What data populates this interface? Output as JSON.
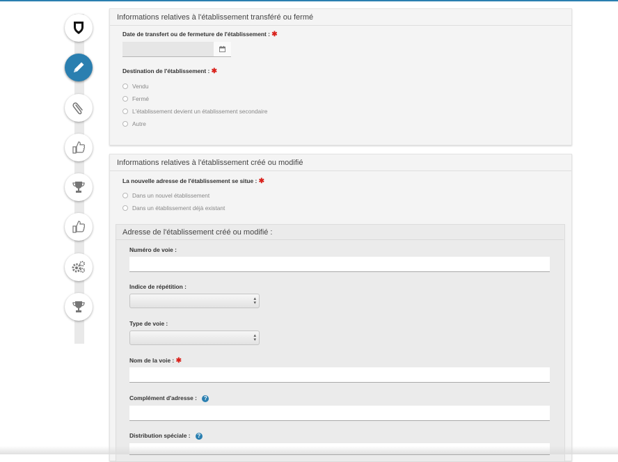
{
  "accent_color": "#2a7fb0",
  "required_color": "#d9211b",
  "steps": [
    {
      "icon": "shield-icon",
      "active": false
    },
    {
      "icon": "pencil-icon",
      "active": true
    },
    {
      "icon": "paperclip-icon",
      "active": false
    },
    {
      "icon": "thumbs-up-icon",
      "active": false
    },
    {
      "icon": "trophy-icon",
      "active": false
    },
    {
      "icon": "thumbs-up-icon",
      "active": false
    },
    {
      "icon": "gears-icon",
      "active": false
    },
    {
      "icon": "trophy-icon",
      "active": false
    }
  ],
  "transfer": {
    "title": "Informations relatives à l'établissement transféré ou fermé",
    "date_label": "Date de transfert ou de fermeture de l'établissement :",
    "required_mark": "✱",
    "destination_label": "Destination de l'établissement :",
    "destination_options": [
      "Vendu",
      "Fermé",
      "L'établissement devient un établissement secondaire",
      "Autre"
    ]
  },
  "created": {
    "title": "Informations relatives à l'établissement créé ou modifié",
    "new_address_label": "La nouvelle adresse de l'établissement se situe :",
    "address_options": [
      "Dans un nouvel établissement",
      "Dans un établissement déjà existant"
    ],
    "address_section": {
      "title": "Adresse de l'établissement créé ou modifié :",
      "fields": {
        "numero_voie": "Numéro de voie :",
        "indice_repetition": "Indice de répétition :",
        "type_voie": "Type de voie :",
        "nom_voie": "Nom de la voie :",
        "complement": "Complément d'adresse :",
        "distribution": "Distribution spéciale :"
      },
      "help_glyph": "?"
    }
  }
}
